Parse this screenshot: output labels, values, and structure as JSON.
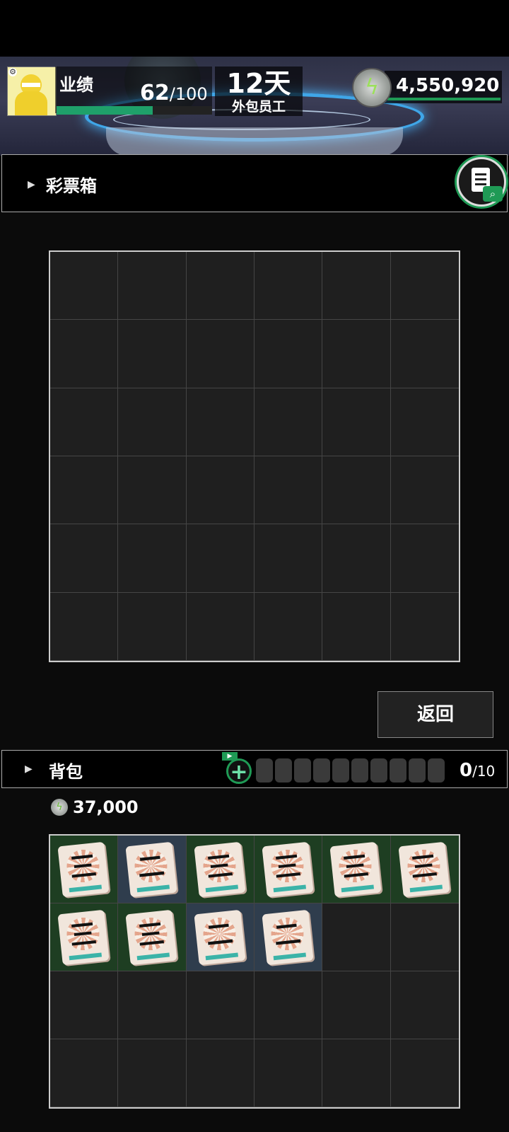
{
  "header": {
    "performance_label": "业绩",
    "performance_current": "62",
    "performance_max": "/100",
    "performance_progress": 0.62,
    "days_value": "12天",
    "days_label": "外包员工",
    "coins": "4,550,920"
  },
  "lottery_box": {
    "title": "彩票箱",
    "grid_rows": 6,
    "grid_cols": 6
  },
  "return_button": "返回",
  "backpack": {
    "title": "背包",
    "slots_current": "0",
    "slots_max": "/10",
    "coins": "37,000",
    "grid_rows": 4,
    "grid_cols": 6,
    "items": [
      {
        "mark": "三",
        "tint": "green"
      },
      {
        "mark": "二",
        "tint": "blue"
      },
      {
        "mark": "三",
        "tint": "green"
      },
      {
        "mark": "三",
        "tint": "green"
      },
      {
        "mark": "三",
        "tint": "green"
      },
      {
        "mark": "三",
        "tint": "green"
      },
      {
        "mark": "三",
        "tint": "green"
      },
      {
        "mark": "三",
        "tint": "green"
      },
      {
        "mark": "二",
        "tint": "blue"
      },
      {
        "mark": "二",
        "tint": "blue"
      }
    ]
  },
  "colors": {
    "accent_green": "#1f9a55",
    "panel_dark": "#1f1f1f",
    "item_green": "#1e3e22",
    "item_blue": "#2f3d4d"
  },
  "icons": [
    "settings-gear-icon",
    "coin-bolt-icon",
    "log-search-icon",
    "add-slot-icon",
    "ad-video-icon",
    "triangle-arrow-icon"
  ]
}
